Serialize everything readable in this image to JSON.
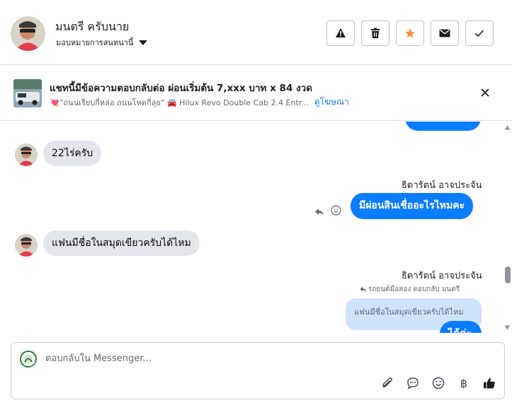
{
  "header": {
    "contact_name": "มนตรี ครับนาย",
    "assign_label": "มอบหมายการสนทนานี้",
    "actions": [
      "report-icon",
      "trash-icon",
      "star-icon",
      "mail-icon",
      "check-icon"
    ],
    "star_color": "#f7923b"
  },
  "banner": {
    "title": "แชทนี้มีข้อความตอบกลับต่อ ผ่อนเริ่มต้น 7,xxx บาท x 84 งวด",
    "subtitle": "💘“ถนนเรียบกี่หล่อ ถนนโหดกี่ลุย” 🚘 Hilux Revo Double Cab 2.4 Entr...",
    "link": "ดูโฆษณา"
  },
  "messages": {
    "m1": "22ไร่ครับ",
    "sender1": "ธิดารัตน์ อาจประจัน",
    "m2": "มีผ่อนสินเชื่ออะไรไหมคะ",
    "m3": "แฟนมีชื่อในสมุดเขียวครับได้ไหม",
    "sender2": "ธิดารัตน์ อาจประจัน",
    "reply_note": "รถยนต์มือสอง ตอบกลับ มนตรี",
    "quoted": "แฟนมีชื่อในสมุดเขียวครับได้ไหม",
    "m4_partial": "ได้ค่ะ"
  },
  "composer": {
    "placeholder": "ตอบกลับใน Messenger...",
    "tools": [
      "attach-icon",
      "saved-reply-icon",
      "emoji-icon",
      "baht-icon",
      "like-icon"
    ]
  },
  "colors": {
    "accent": "#0a7cff",
    "link": "#1877f2",
    "incoming_bubble": "#e4e6eb",
    "quoted_bubble": "#cfe3ff"
  }
}
